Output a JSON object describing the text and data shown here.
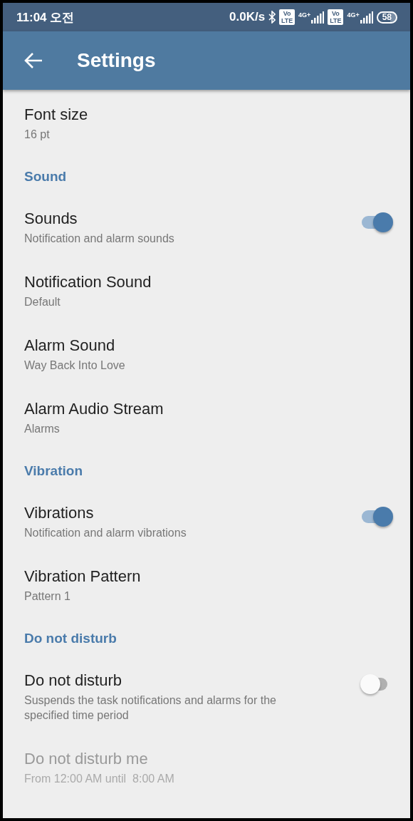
{
  "status_bar": {
    "time": "11:04 오전",
    "speed": "0.0K/s",
    "sims": [
      {
        "volte": [
          "Vo",
          "LTE"
        ],
        "network": "4G+"
      },
      {
        "volte": [
          "Vo",
          "LTE"
        ],
        "network": "4G+"
      }
    ],
    "battery": "58"
  },
  "app_bar": {
    "title": "Settings"
  },
  "items": [
    {
      "kind": "item",
      "title": "Font size",
      "subtitle": "16 pt",
      "disabled": false
    },
    {
      "kind": "section",
      "title": "Sound"
    },
    {
      "kind": "toggle",
      "title": "Sounds",
      "subtitle": "Notification and alarm sounds",
      "on": true,
      "disabled": false
    },
    {
      "kind": "item",
      "title": "Notification Sound",
      "subtitle": "Default",
      "disabled": false
    },
    {
      "kind": "item",
      "title": "Alarm Sound",
      "subtitle": "Way Back Into Love",
      "disabled": false
    },
    {
      "kind": "item",
      "title": "Alarm Audio Stream",
      "subtitle": "Alarms",
      "disabled": false
    },
    {
      "kind": "section",
      "title": "Vibration"
    },
    {
      "kind": "toggle",
      "title": "Vibrations",
      "subtitle": "Notification and alarm vibrations",
      "on": true,
      "disabled": false
    },
    {
      "kind": "item",
      "title": "Vibration Pattern",
      "subtitle": "Pattern 1",
      "disabled": false
    },
    {
      "kind": "section",
      "title": "Do not disturb"
    },
    {
      "kind": "toggle",
      "title": "Do not disturb",
      "subtitle": "Suspends the task notifications and alarms for the specified time period",
      "on": false,
      "disabled": false
    },
    {
      "kind": "item",
      "title": "Do not disturb me",
      "subtitle": "From 12:00 AM until  8:00 AM",
      "disabled": true
    }
  ]
}
